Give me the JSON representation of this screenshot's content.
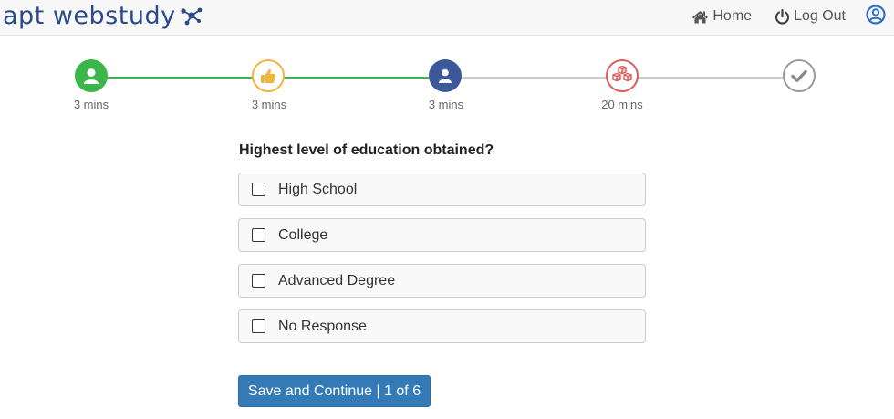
{
  "header": {
    "logo_text": "apt webstudy",
    "nav": {
      "home_label": "Home",
      "logout_label": "Log Out"
    }
  },
  "progress": {
    "steps": [
      {
        "label": "3 mins",
        "icon": "user-icon",
        "state": "complete",
        "color": "#3cb54a"
      },
      {
        "label": "3 mins",
        "icon": "thumbs-up-icon",
        "state": "complete",
        "color": "#f0b43c"
      },
      {
        "label": "3 mins",
        "icon": "user-icon",
        "state": "current",
        "color": "#3b5998"
      },
      {
        "label": "20 mins",
        "icon": "cubes-icon",
        "state": "upcoming",
        "color": "#e05a5a"
      },
      {
        "label": "",
        "icon": "checkmark-icon",
        "state": "upcoming",
        "color": "#9a9a9a"
      }
    ]
  },
  "form": {
    "question": "Highest level of education obtained?",
    "options": [
      {
        "label": "High School",
        "checked": false
      },
      {
        "label": "College",
        "checked": false
      },
      {
        "label": "Advanced Degree",
        "checked": false
      },
      {
        "label": "No Response",
        "checked": false
      }
    ],
    "submit_label": "Save and Continue | 1 of 6"
  },
  "colors": {
    "brand": "#2a4a8a",
    "complete_line": "#3cb54a",
    "pending_line": "#cccccc",
    "button": "#337ab7"
  }
}
